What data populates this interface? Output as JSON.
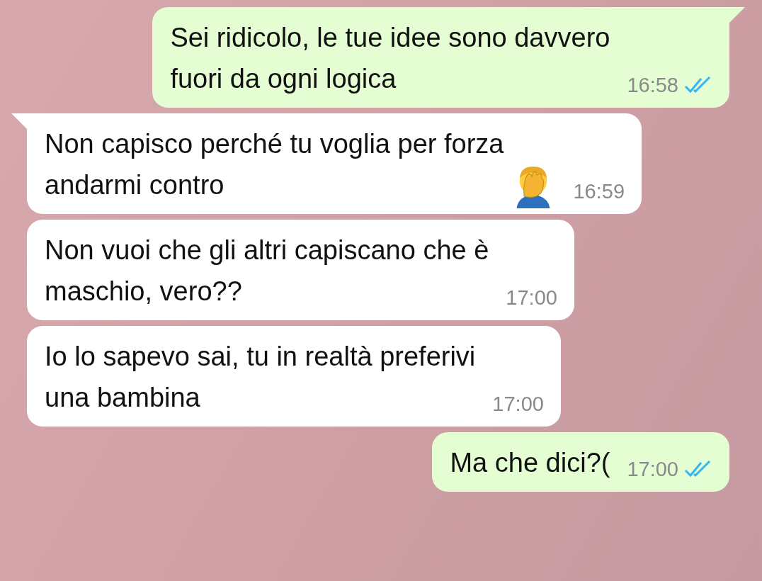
{
  "messages": [
    {
      "kind": "outgoing",
      "tail": true,
      "text": "Sei ridicolo, le tue idee sono davvero\nfuori da ogni logica",
      "time": "16:58",
      "read": true,
      "emoji_after": false
    },
    {
      "kind": "incoming",
      "tail": true,
      "text": "Non capisco perché tu voglia per forza\nandarmi contro",
      "time": "16:59",
      "emoji_after": true
    },
    {
      "kind": "incoming",
      "tail": false,
      "text": "Non vuoi che gli altri capiscano che è\nmaschio, vero??",
      "time": "17:00",
      "emoji_after": false
    },
    {
      "kind": "incoming",
      "tail": false,
      "text": "Io lo sapevo sai, tu in realtà preferivi\nuna bambina",
      "time": "17:00",
      "emoji_after": false
    },
    {
      "kind": "outgoing",
      "tail": false,
      "text": "Ma che dici?(",
      "time": "17:00",
      "read": true,
      "emoji_after": false
    }
  ]
}
